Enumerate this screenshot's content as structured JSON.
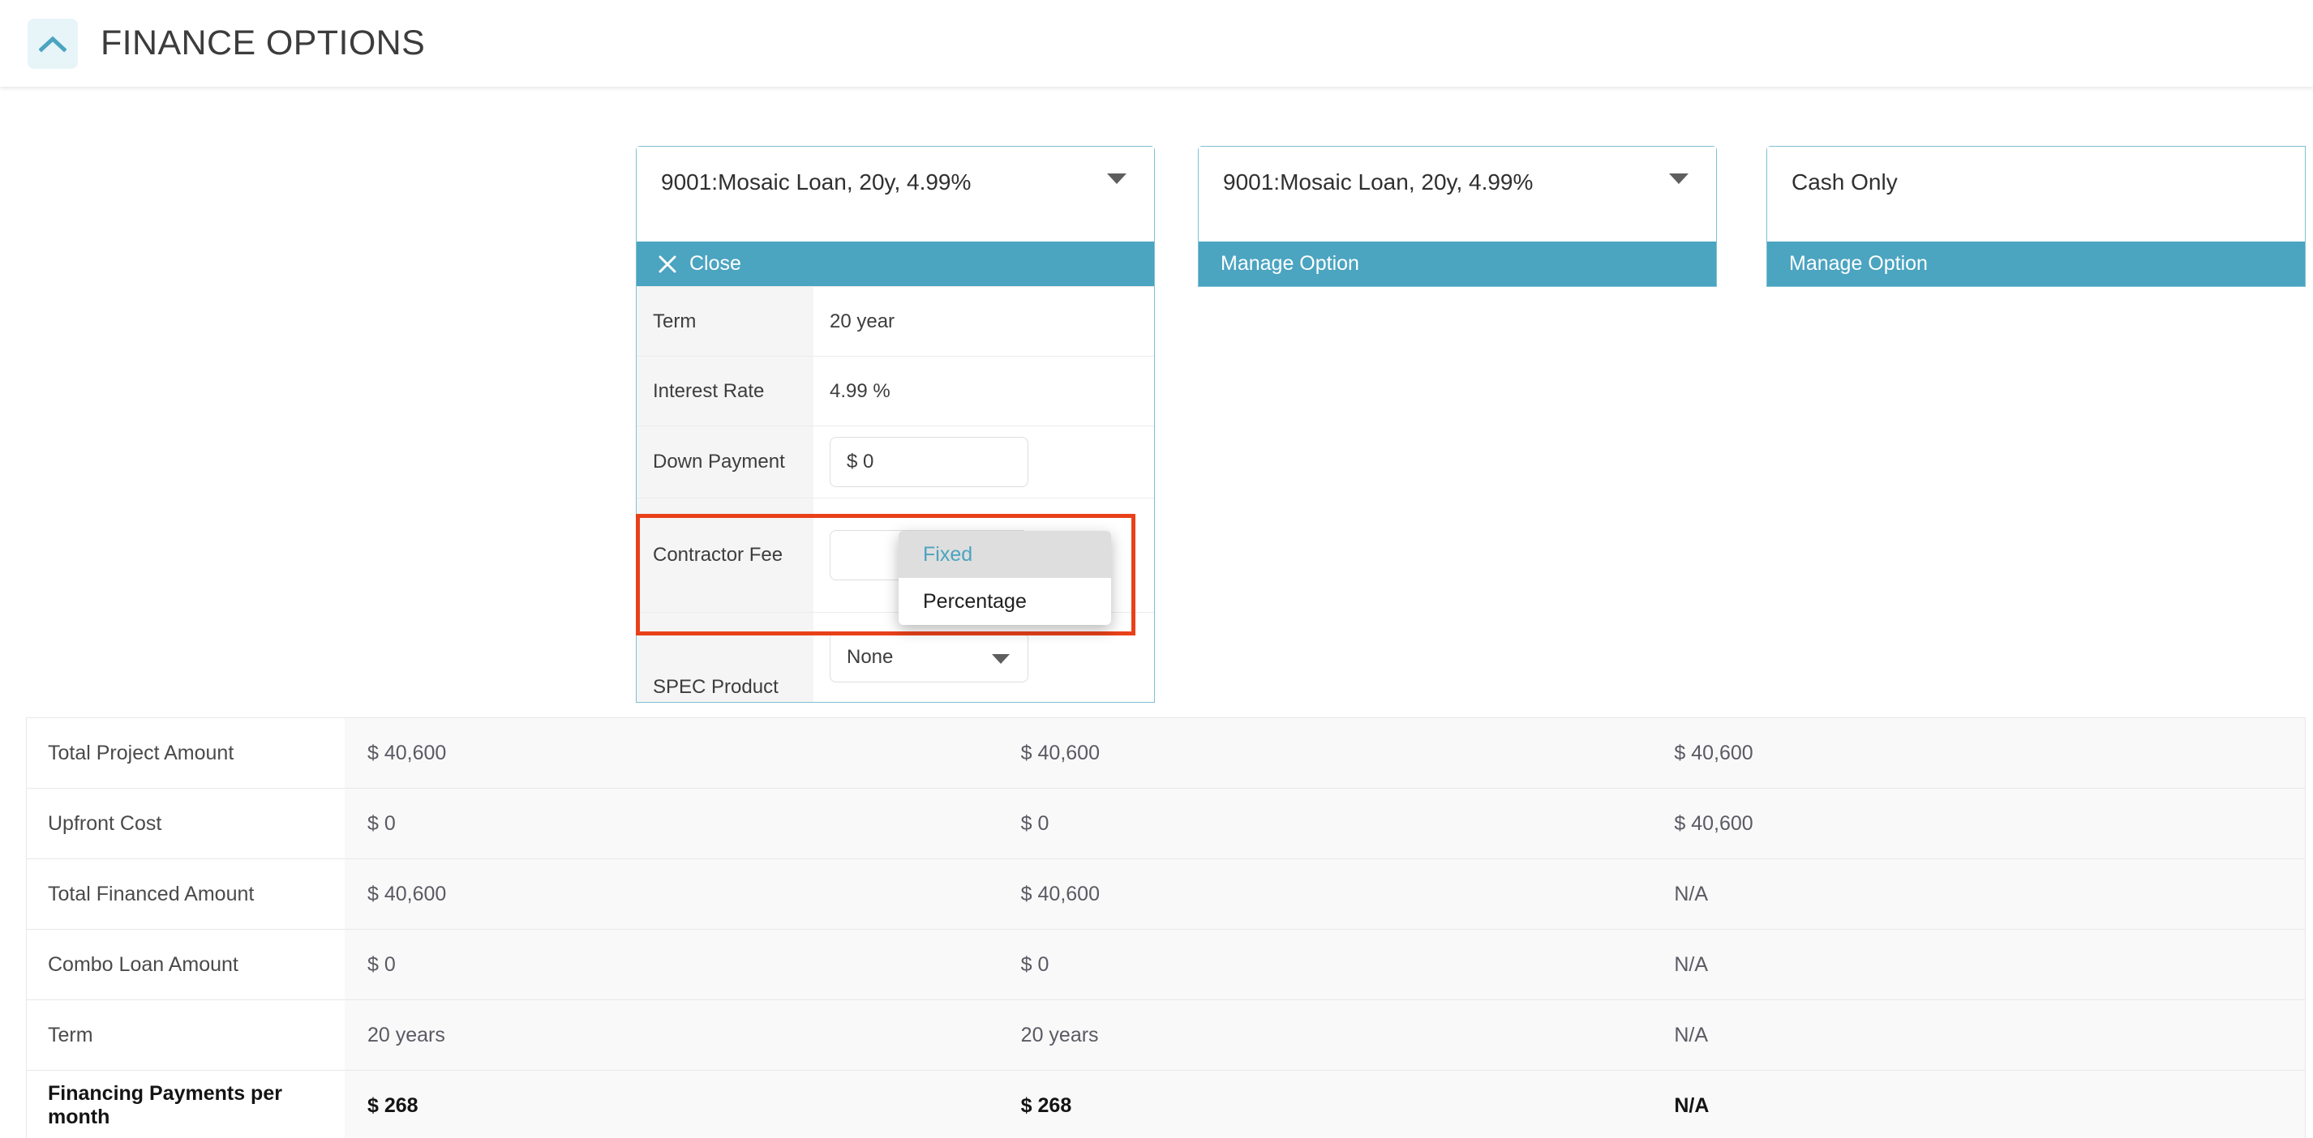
{
  "header": {
    "title": "FINANCE OPTIONS",
    "collapse_icon": "chevron-up-icon",
    "accent_color": "#4ba4c0",
    "collapse_bg": "#e7f5f8"
  },
  "colors": {
    "teal": "#4ba4c0",
    "highlight_red": "#e8411a",
    "row_value_bg": "#f9f9f9",
    "detail_label_bg": "#f5f5f5",
    "dropdown_selected_bg": "#dedede"
  },
  "cards": [
    {
      "select_value": "9001:Mosaic Loan, 20y, 4.99%",
      "caret_icon": "chevron-down-icon",
      "action_label": "Close",
      "action_icon": "close-x-icon",
      "rows": [
        {
          "label": "Term",
          "value": "20 year",
          "kind": "text"
        },
        {
          "label": "Interest Rate",
          "value": "4.99 %",
          "kind": "text"
        },
        {
          "label": "Down Payment",
          "value": "$ 0",
          "kind": "input"
        },
        {
          "label": "Contractor Fee",
          "value": "",
          "kind": "select"
        },
        {
          "label": "SPEC Product",
          "value": "None",
          "kind": "select"
        }
      ]
    },
    {
      "select_value": "9001:Mosaic Loan, 20y, 4.99%",
      "caret_icon": "chevron-down-icon",
      "action_label": "Manage Option"
    },
    {
      "select_value": "Cash Only",
      "action_label": "Manage Option"
    }
  ],
  "dropdown": {
    "open": true,
    "field": "Contractor Fee",
    "options": [
      {
        "label": "Fixed",
        "selected": true
      },
      {
        "label": "Percentage",
        "selected": false
      }
    ]
  },
  "summary": {
    "rows": [
      {
        "label": "Total Project Amount",
        "values": [
          "$ 40,600",
          "$ 40,600",
          "$ 40,600"
        ],
        "total": false
      },
      {
        "label": "Upfront Cost",
        "values": [
          "$ 0",
          "$ 0",
          "$ 40,600"
        ],
        "total": false
      },
      {
        "label": "Total Financed Amount",
        "values": [
          "$ 40,600",
          "$ 40,600",
          "N/A"
        ],
        "total": false
      },
      {
        "label": "Combo Loan Amount",
        "values": [
          "$ 0",
          "$ 0",
          "N/A"
        ],
        "total": false
      },
      {
        "label": "Term",
        "values": [
          "20 years",
          "20 years",
          "N/A"
        ],
        "total": false
      },
      {
        "label": "Financing Payments per month",
        "values": [
          "$ 268",
          "$ 268",
          "N/A"
        ],
        "total": true
      }
    ]
  }
}
